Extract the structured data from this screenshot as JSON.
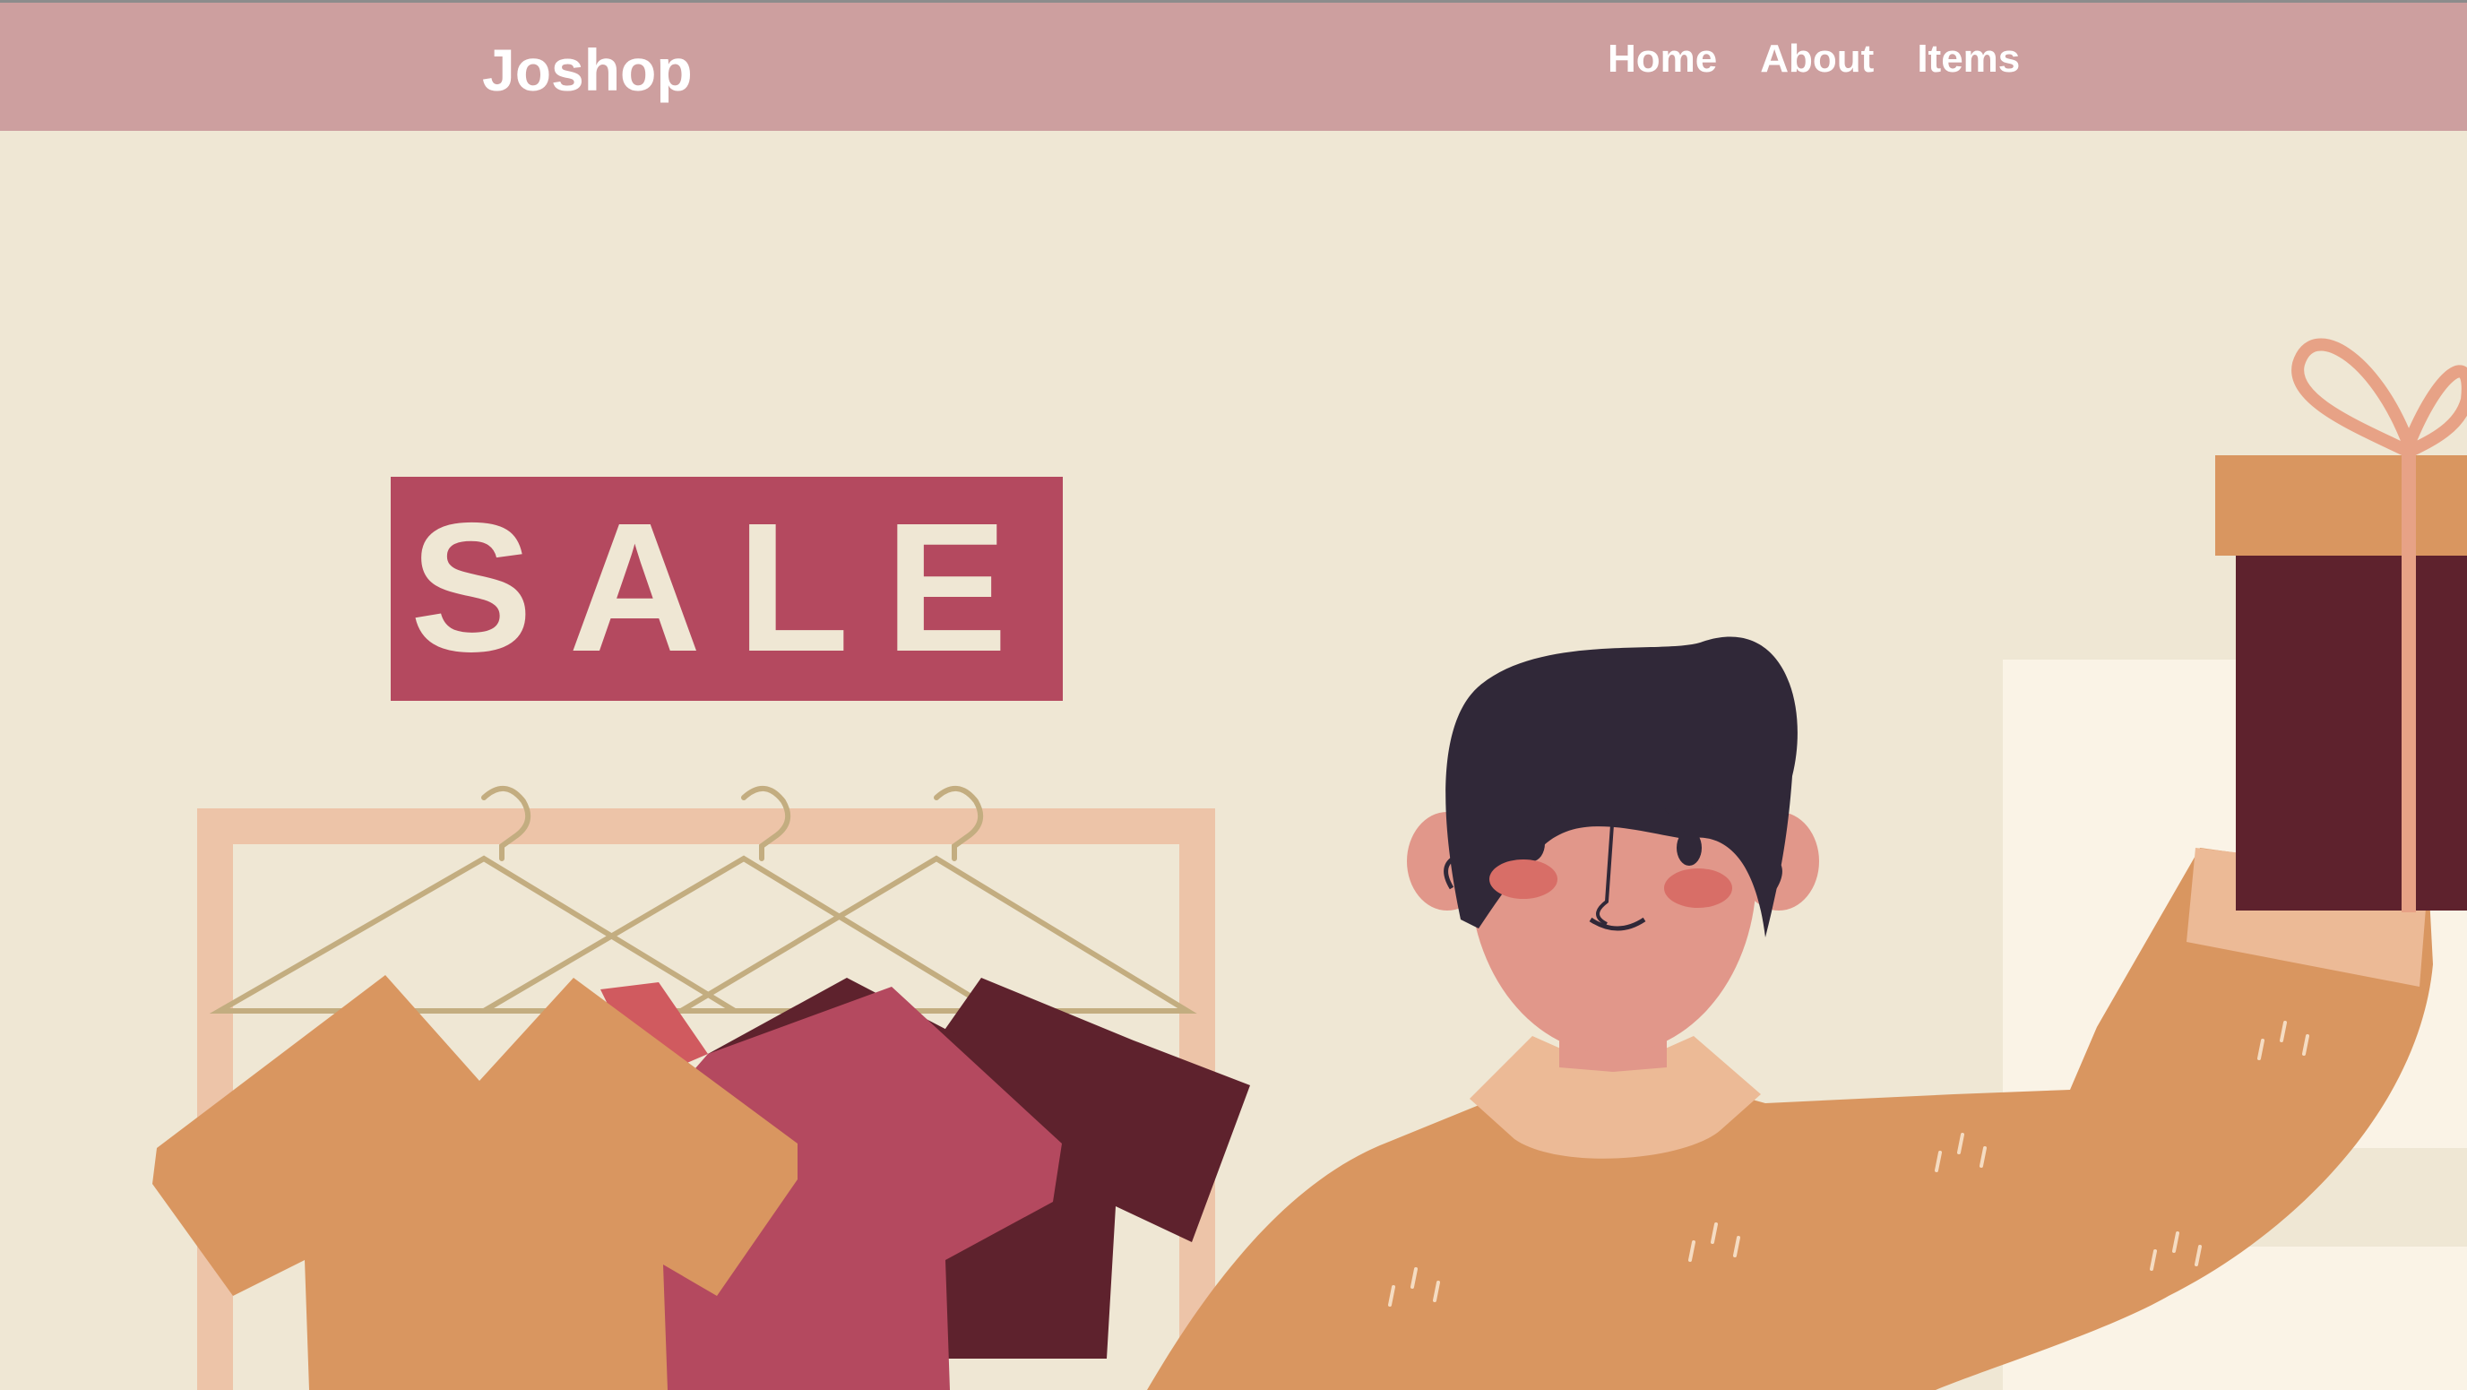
{
  "navbar": {
    "brand": "Joshop",
    "links": [
      {
        "label": "Home"
      },
      {
        "label": "About"
      },
      {
        "label": "Items"
      }
    ],
    "background_color": "#cd9f9f"
  },
  "hero": {
    "sale_sign_text": "SALE",
    "colors": {
      "background": "#efe7d4",
      "sale_sign": "#b4495f",
      "sale_text": "#efe7d4",
      "rack": "#edc4a8",
      "hanger": "#c3ad80",
      "shirt_orange": "#d99660",
      "shirt_pink": "#b4495f",
      "shirt_maroon": "#5e222d",
      "sweater": "#d99660",
      "hair": "#302838",
      "skin": "#e1978a",
      "gift_lid": "#d99660",
      "gift_box": "#5e222d"
    }
  }
}
